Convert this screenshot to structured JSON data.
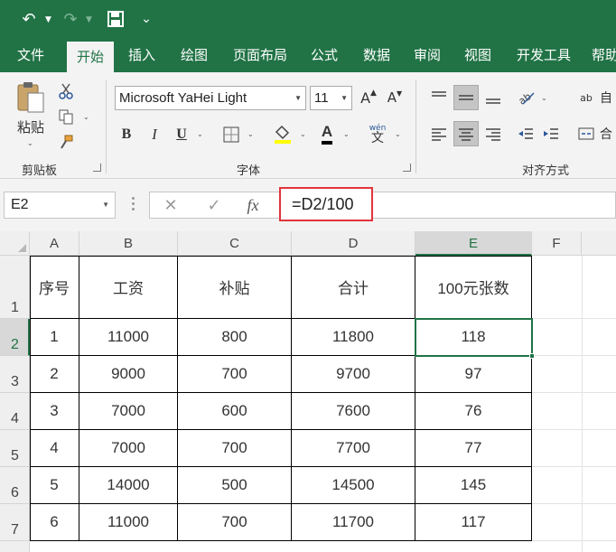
{
  "quick_access": {
    "undo_icon": "↶",
    "redo_icon": "↷",
    "save_icon": "save-icon",
    "customize_icon": "⌄"
  },
  "tabs": [
    "文件",
    "开始",
    "插入",
    "绘图",
    "页面布局",
    "公式",
    "数据",
    "审阅",
    "视图",
    "开发工具",
    "帮助"
  ],
  "ribbon": {
    "clipboard": {
      "paste_label": "粘贴",
      "group_label": "剪贴板"
    },
    "font": {
      "font_name": "Microsoft YaHei Light",
      "font_size": "11",
      "grow_label": "A",
      "shrink_label": "A",
      "bold": "B",
      "italic": "I",
      "underline": "U",
      "font_color_label": "A",
      "phonetic_label": "wén",
      "group_label": "字体"
    },
    "alignment": {
      "wrap_label": "自",
      "merge_label": "合",
      "group_label": "对齐方式"
    }
  },
  "formula_bar": {
    "name_box": "E2",
    "fx_label": "fx",
    "formula": "=D2/100"
  },
  "sheet": {
    "columns": [
      "A",
      "B",
      "C",
      "D",
      "E",
      "F"
    ],
    "rows": [
      "1",
      "2",
      "3",
      "4",
      "5",
      "6",
      "7"
    ],
    "selected_column": "E",
    "selected_row": "2",
    "headers": [
      "序号",
      "工资",
      "补贴",
      "合计",
      "100元张数"
    ],
    "data": [
      [
        "1",
        "11000",
        "800",
        "11800",
        "118"
      ],
      [
        "2",
        "9000",
        "700",
        "9700",
        "97"
      ],
      [
        "3",
        "7000",
        "600",
        "7600",
        "76"
      ],
      [
        "4",
        "7000",
        "700",
        "7700",
        "77"
      ],
      [
        "5",
        "14000",
        "500",
        "14500",
        "145"
      ],
      [
        "6",
        "11000",
        "700",
        "11700",
        "117"
      ]
    ]
  },
  "colors": {
    "accent": "#217346",
    "highlight_border": "#e0353b"
  }
}
